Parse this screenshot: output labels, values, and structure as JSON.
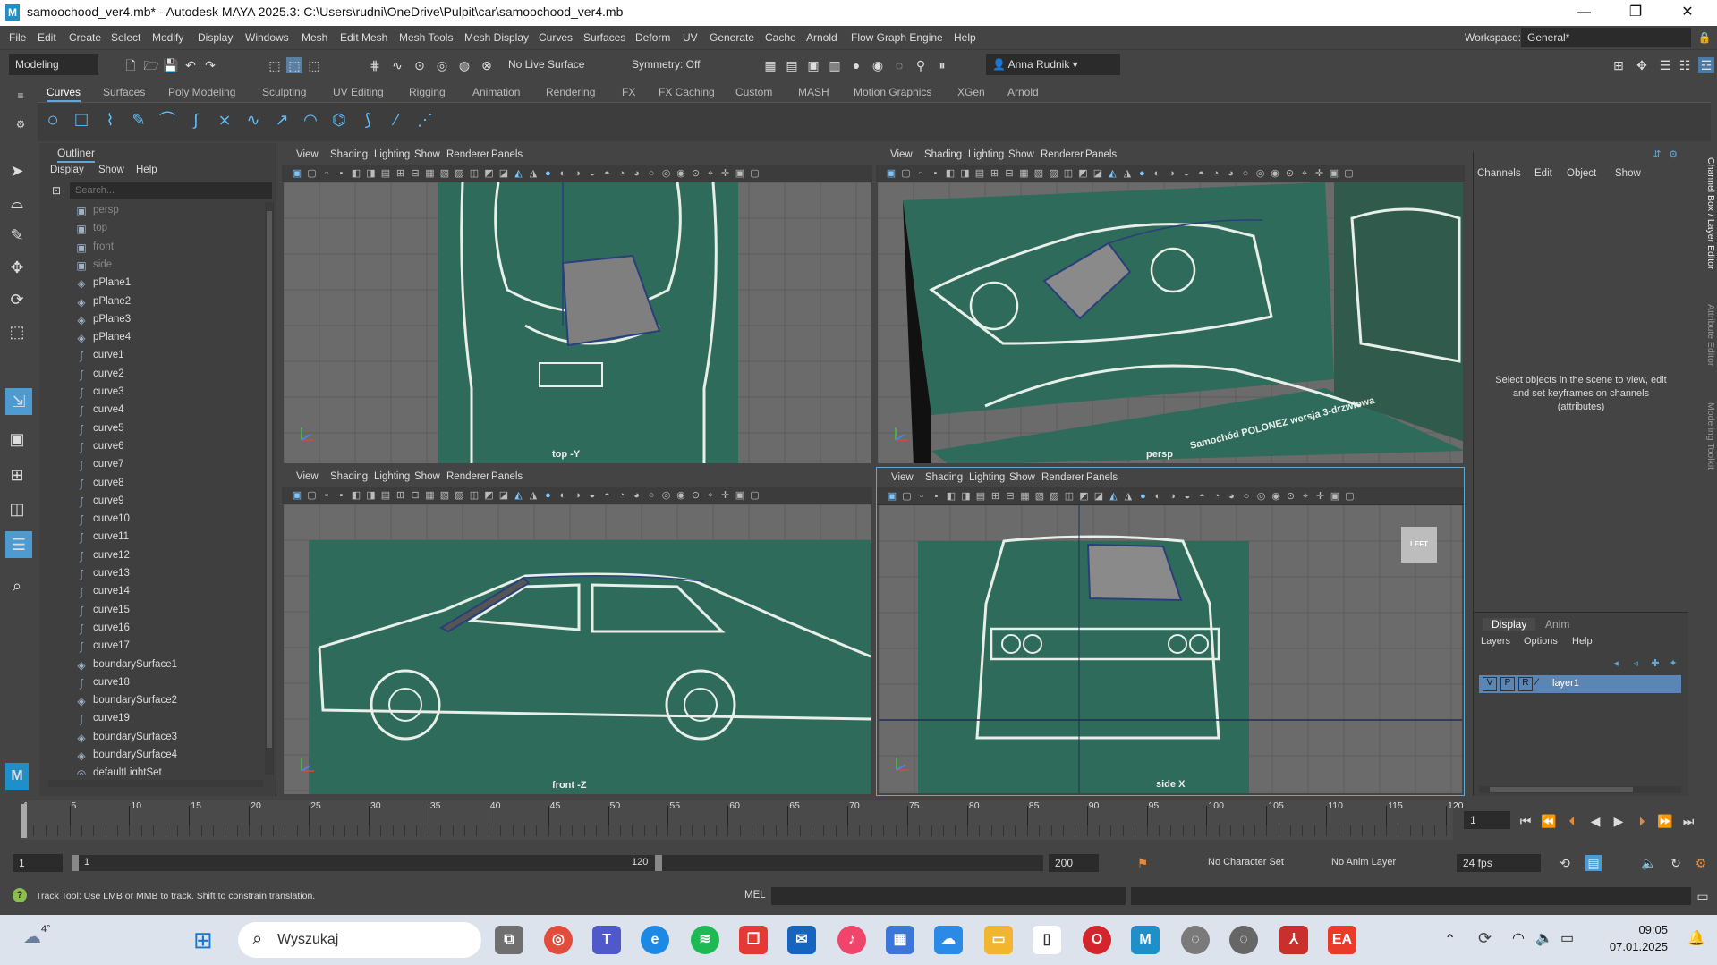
{
  "titlebar": {
    "title": "samoochood_ver4.mb* - Autodesk MAYA 2025.3: C:\\Users\\rudni\\OneDrive\\Pulpit\\car\\samoochood_ver4.mb",
    "minimize": "—",
    "maximize": "❐",
    "close": "✕"
  },
  "menu": [
    "File",
    "Edit",
    "Create",
    "Select",
    "Modify",
    "Display",
    "Windows",
    "Mesh",
    "Edit Mesh",
    "Mesh Tools",
    "Mesh Display",
    "Curves",
    "Surfaces",
    "Deform",
    "UV",
    "Generate",
    "Cache",
    "Arnold",
    "Flow Graph Engine",
    "Help"
  ],
  "workspace": {
    "label": "Workspace:",
    "value": "General*"
  },
  "statusline": {
    "mode": "Modeling",
    "live_surface": "No Live Surface",
    "symmetry": "Symmetry: Off",
    "user": "Anna Rudnik"
  },
  "shelf_tabs": [
    "Curves",
    "Surfaces",
    "Poly Modeling",
    "Sculpting",
    "UV Editing",
    "Rigging",
    "Animation",
    "Rendering",
    "FX",
    "FX Caching",
    "Custom",
    "MASH",
    "Motion Graphics",
    "XGen",
    "Arnold"
  ],
  "outliner": {
    "title": "Outliner",
    "menu": [
      "Display",
      "Show",
      "Help"
    ],
    "search_placeholder": "Search...",
    "items": [
      {
        "name": "persp",
        "icon": "camera-icon",
        "dim": true
      },
      {
        "name": "top",
        "icon": "camera-icon",
        "dim": true
      },
      {
        "name": "front",
        "icon": "camera-icon",
        "dim": true
      },
      {
        "name": "side",
        "icon": "camera-icon",
        "dim": true
      },
      {
        "name": "pPlane1",
        "icon": "mesh-icon"
      },
      {
        "name": "pPlane2",
        "icon": "mesh-icon"
      },
      {
        "name": "pPlane3",
        "icon": "mesh-icon"
      },
      {
        "name": "pPlane4",
        "icon": "mesh-icon"
      },
      {
        "name": "curve1",
        "icon": "curve-icon"
      },
      {
        "name": "curve2",
        "icon": "curve-icon"
      },
      {
        "name": "curve3",
        "icon": "curve-icon"
      },
      {
        "name": "curve4",
        "icon": "curve-icon"
      },
      {
        "name": "curve5",
        "icon": "curve-icon"
      },
      {
        "name": "curve6",
        "icon": "curve-icon"
      },
      {
        "name": "curve7",
        "icon": "curve-icon"
      },
      {
        "name": "curve8",
        "icon": "curve-icon"
      },
      {
        "name": "curve9",
        "icon": "curve-icon"
      },
      {
        "name": "curve10",
        "icon": "curve-icon"
      },
      {
        "name": "curve11",
        "icon": "curve-icon"
      },
      {
        "name": "curve12",
        "icon": "curve-icon"
      },
      {
        "name": "curve13",
        "icon": "curve-icon"
      },
      {
        "name": "curve14",
        "icon": "curve-icon"
      },
      {
        "name": "curve15",
        "icon": "curve-icon"
      },
      {
        "name": "curve16",
        "icon": "curve-icon"
      },
      {
        "name": "curve17",
        "icon": "curve-icon"
      },
      {
        "name": "boundarySurface1",
        "icon": "mesh-icon"
      },
      {
        "name": "curve18",
        "icon": "curve-icon"
      },
      {
        "name": "boundarySurface2",
        "icon": "mesh-icon"
      },
      {
        "name": "curve19",
        "icon": "curve-icon"
      },
      {
        "name": "boundarySurface3",
        "icon": "mesh-icon"
      },
      {
        "name": "boundarySurface4",
        "icon": "mesh-icon"
      },
      {
        "name": "defaultLightSet",
        "icon": "set-icon"
      }
    ]
  },
  "viewport_menu": [
    "View",
    "Shading",
    "Lighting",
    "Show",
    "Renderer",
    "Panels"
  ],
  "viewports": [
    {
      "label": "top -Y"
    },
    {
      "label": "persp"
    },
    {
      "label": "front -Z"
    },
    {
      "label": "side X"
    }
  ],
  "blueprint_text": "Samochód POLONEZ wersja 3-drzwiowa",
  "view_cube": "LEFT",
  "channelbox": {
    "menu": [
      "Channels",
      "Edit",
      "Object",
      "Show"
    ],
    "hint": "Select objects in the scene to view, edit and set keyframes on channels (attributes)"
  },
  "side_tabs": [
    "Channel Box / Layer Editor",
    "Attribute Editor",
    "Modeling Toolkit"
  ],
  "layers": {
    "tabs": [
      "Display",
      "Anim"
    ],
    "menu": [
      "Layers",
      "Options",
      "Help"
    ],
    "layer_name": "layer1",
    "v": "V",
    "p": "P",
    "r": "R"
  },
  "timeline": {
    "ticks": [
      "1",
      "5",
      "10",
      "15",
      "20",
      "25",
      "30",
      "35",
      "40",
      "45",
      "50",
      "55",
      "60",
      "65",
      "70",
      "75",
      "80",
      "85",
      "90",
      "95",
      "100",
      "105",
      "110",
      "115",
      "120"
    ],
    "current": "1"
  },
  "range": {
    "start": "1",
    "inner_start": "1",
    "inner_end": "120",
    "end": "200",
    "character_set": "No Character Set",
    "anim_layer": "No Anim Layer",
    "fps": "24 fps"
  },
  "cmd": {
    "help": "Track Tool: Use LMB or MMB to track. Shift to constrain translation.",
    "lang": "MEL"
  },
  "taskbar": {
    "weather": "4°",
    "search": "Wyszukaj",
    "time": "09:05",
    "date": "07.01.2025"
  },
  "colors": {
    "blueprint": "#2f6b5a",
    "selected_layer": "#5a86b5",
    "accent": "#5fa8d8"
  }
}
